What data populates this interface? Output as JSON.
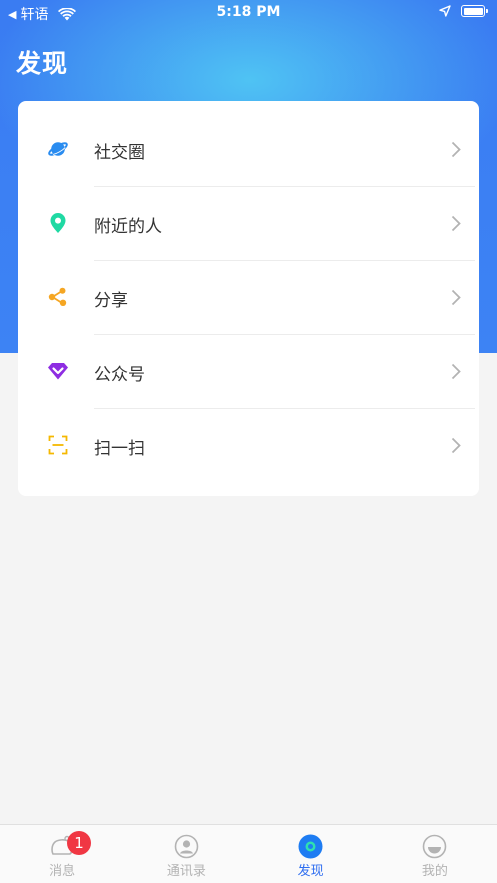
{
  "status_bar": {
    "back_label": "轩语",
    "time": "5:18 PM"
  },
  "page": {
    "title": "发现"
  },
  "menu": {
    "items": [
      {
        "label": "社交圈",
        "icon": "planet-icon",
        "color": "#2a8cf0"
      },
      {
        "label": "附近的人",
        "icon": "location-pin-icon",
        "color": "#1fd9a3"
      },
      {
        "label": "分享",
        "icon": "share-icon",
        "color": "#f5a623"
      },
      {
        "label": "公众号",
        "icon": "diamond-icon",
        "color": "#8e2de2"
      },
      {
        "label": "扫一扫",
        "icon": "scan-icon",
        "color": "#f5b800"
      }
    ]
  },
  "tabbar": {
    "tabs": [
      {
        "label": "消息",
        "icon": "message-icon",
        "badge": "1"
      },
      {
        "label": "通讯录",
        "icon": "contacts-icon"
      },
      {
        "label": "发现",
        "icon": "discover-icon",
        "active": true
      },
      {
        "label": "我的",
        "icon": "profile-icon"
      }
    ]
  },
  "colors": {
    "accent": "#2f6ef0",
    "badge": "#f03743",
    "header_blue": "#3a7cf2"
  }
}
